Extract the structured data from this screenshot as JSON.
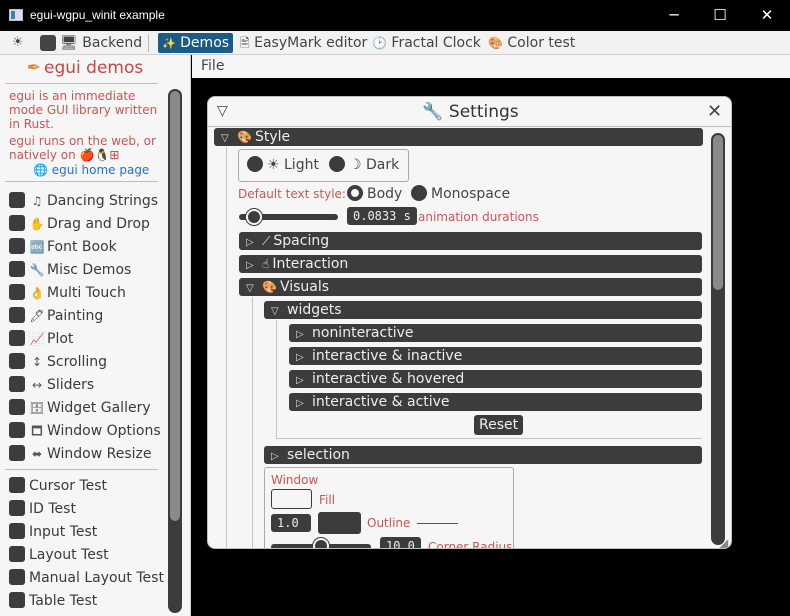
{
  "window": {
    "title": "egui-wgpu_winit example",
    "minimize_glyph": "─",
    "maximize_glyph": "☐",
    "close_glyph": "✕"
  },
  "topbar": {
    "theme_icon": "☀",
    "backend_label": "🖥 Backend",
    "tabs": [
      {
        "label": "Demos",
        "icon": "✨"
      },
      {
        "label": "EasyMark editor",
        "icon": "🖹"
      },
      {
        "label": "Fractal Clock",
        "icon": "🕑"
      },
      {
        "label": "Color test",
        "icon": "🎨"
      }
    ]
  },
  "sidebar": {
    "heading": "egui demos",
    "heading_icon": "✒",
    "intro": "egui is an immediate mode GUI library written in Rust.",
    "web_note": "egui runs on the web, or natively on",
    "platform_icons": "🍎🐧⊞",
    "home_link": "🌐 egui home page",
    "demos": [
      {
        "icon": "♫",
        "label": "Dancing Strings"
      },
      {
        "icon": "✋",
        "label": "Drag and Drop"
      },
      {
        "icon": "🔤",
        "label": "Font Book"
      },
      {
        "icon": "🔧",
        "label": "Misc Demos"
      },
      {
        "icon": "👌",
        "label": "Multi Touch"
      },
      {
        "icon": "🖊",
        "label": "Painting"
      },
      {
        "icon": "📈",
        "label": "Plot"
      },
      {
        "icon": "↕",
        "label": "Scrolling"
      },
      {
        "icon": "↔",
        "label": "Sliders"
      },
      {
        "icon": "🗄",
        "label": "Widget Gallery"
      },
      {
        "icon": "🗖",
        "label": "Window Options"
      },
      {
        "icon": "⬌",
        "label": "Window Resize"
      }
    ],
    "tests": [
      {
        "label": "Cursor Test"
      },
      {
        "label": "ID Test"
      },
      {
        "label": "Input Test"
      },
      {
        "label": "Layout Test"
      },
      {
        "label": "Manual Layout Test"
      },
      {
        "label": "Table Test"
      }
    ]
  },
  "menubar": {
    "file": "File"
  },
  "settings": {
    "title": "🔧 Settings",
    "collapse_glyph": "▽",
    "close_glyph": "✕",
    "style_header": {
      "icon": "🎨",
      "label": "Style"
    },
    "theme_light": "☀ Light",
    "theme_dark": "☽ Dark",
    "text_style_label": "Default text style:",
    "text_style_body": "Body",
    "text_style_mono": "Monospace",
    "anim_value": "0.0833 s",
    "anim_label": "animation durations",
    "spacing": {
      "icon": "⟋",
      "label": "Spacing"
    },
    "interaction": {
      "icon": "☝",
      "label": "Interaction"
    },
    "visuals": {
      "icon": "🎨",
      "label": "Visuals"
    },
    "widgets": {
      "label": "widgets"
    },
    "widget_states": [
      "noninteractive",
      "interactive & inactive",
      "interactive & hovered",
      "interactive & active"
    ],
    "reset": "Reset",
    "selection": "selection",
    "window_label": "Window",
    "fill_label": "Fill",
    "outline_value": "1.0",
    "outline_label": "Outline",
    "corner_value": "10.0",
    "corner_label": "Corner Radius",
    "arrow_open": "▽",
    "arrow_closed": "▷"
  },
  "colors": {
    "panel_bg": "#f6f6f6",
    "widget_dark": "#3c3c3c",
    "accent_label": "#cc5555",
    "link": "#2a6fc9",
    "selected_tab": "#1d5b87"
  }
}
